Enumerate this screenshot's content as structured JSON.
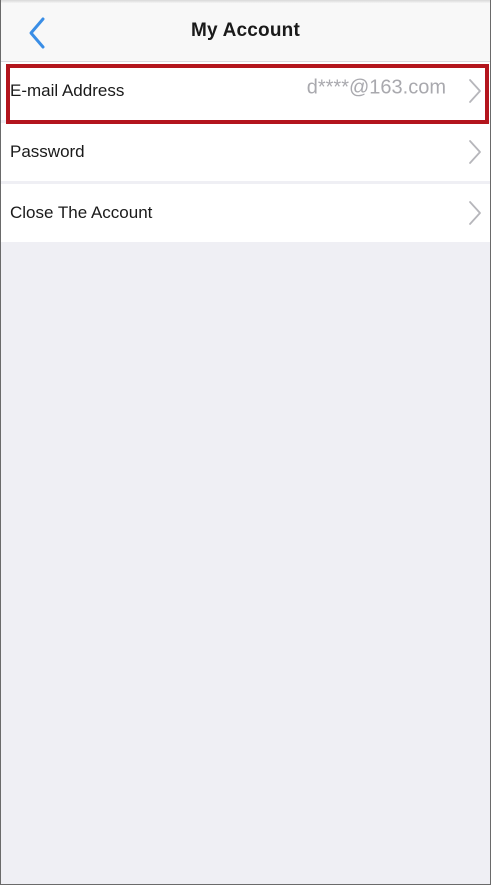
{
  "header": {
    "back_icon": "chevron-left-icon",
    "title": "My Account"
  },
  "rows": [
    {
      "label": "E-mail Address",
      "value": "d****@163.com",
      "icon": "chevron-right-icon"
    },
    {
      "label": "Password",
      "value": "",
      "icon": "chevron-right-icon"
    },
    {
      "label": "Close The Account",
      "value": "",
      "icon": "chevron-right-icon"
    }
  ],
  "colors": {
    "accent": "#3a8ee6",
    "highlight": "#b3151d",
    "background": "#efeff4",
    "value_text": "#a9a9ae"
  }
}
